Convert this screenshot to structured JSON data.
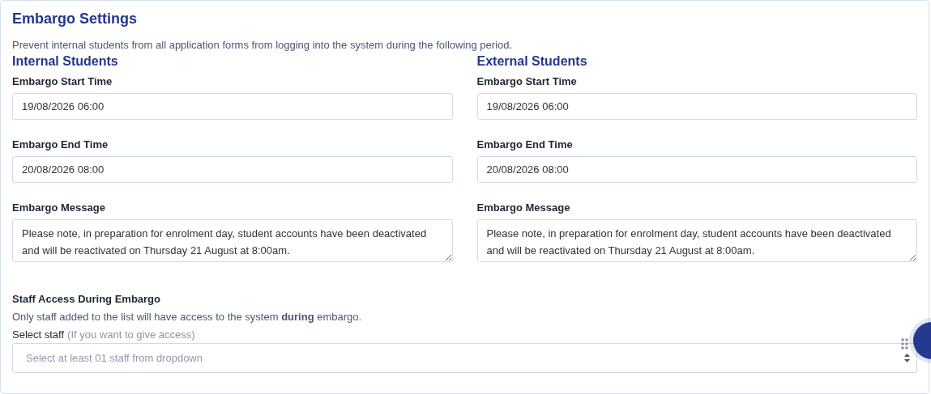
{
  "title": "Embargo Settings",
  "description": "Prevent internal students from all application forms from logging into the system during the following period.",
  "groups": [
    {
      "heading": "Internal Students",
      "fields": [
        {
          "kind": "input",
          "label": "Embargo Start Time",
          "value": "19/08/2026 06:00"
        },
        {
          "kind": "input",
          "label": "Embargo End Time",
          "value": "20/08/2026 08:00"
        },
        {
          "kind": "textarea",
          "label": "Embargo Message",
          "value": "Please note, in preparation for enrolment day, student accounts have been deactivated and will be reactivated on Thursday 21 August at 8:00am."
        }
      ]
    },
    {
      "heading": "External Students",
      "fields": [
        {
          "kind": "input",
          "label": "Embargo Start Time",
          "value": "19/08/2026 06:00"
        },
        {
          "kind": "input",
          "label": "Embargo End Time",
          "value": "20/08/2026 08:00"
        },
        {
          "kind": "textarea",
          "label": "Embargo Message",
          "value": "Please note, in preparation for enrolment day, student accounts have been deactivated and will be reactivated on Thursday 21 August at 8:00am."
        }
      ]
    }
  ],
  "staff": {
    "heading": "Staff Access During Embargo",
    "note": "Only staff added to the list will have access to the system **during** embargo.",
    "select_label": "Select staff",
    "select_hint": "(If you want to give access)",
    "placeholder": "Select at least 01 staff from dropdown"
  }
}
